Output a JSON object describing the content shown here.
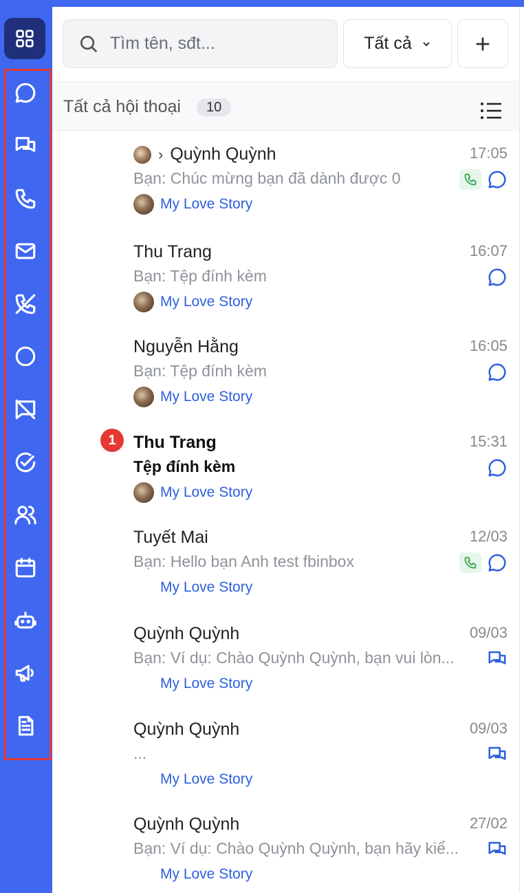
{
  "search": {
    "placeholder": "Tìm tên, sđt..."
  },
  "filter": {
    "label": "Tất cả"
  },
  "list_header": {
    "title": "Tất cả hội thoại",
    "count": "10"
  },
  "conversations": [
    {
      "name": "Quỳnh Quỳnh",
      "time": "17:05",
      "preview": "Bạn: Chúc mừng bạn đã dành được 0",
      "page": "My Love Story"
    },
    {
      "name": "Thu Trang",
      "time": "16:07",
      "preview": "Bạn: Tệp đính kèm",
      "page": "My Love Story"
    },
    {
      "name": "Nguyễn Hằng",
      "time": "16:05",
      "preview": "Bạn: Tệp đính kèm",
      "page": "My Love Story"
    },
    {
      "name": "Thu Trang",
      "time": "15:31",
      "preview": "Tệp đính kèm",
      "page": "My Love Story",
      "unread": "1"
    },
    {
      "name": "Tuyết Mai",
      "time": "12/03",
      "preview": "Bạn: Hello bạn Anh test fbinbox",
      "page": "My Love Story"
    },
    {
      "name": "Quỳnh Quỳnh",
      "time": "09/03",
      "preview": "Bạn: Ví dụ: Chào Quỳnh Quỳnh, bạn vui lòn...",
      "page": "My Love Story"
    },
    {
      "name": "Quỳnh Quỳnh",
      "time": "09/03",
      "preview": "...",
      "page": "My Love Story"
    },
    {
      "name": "Quỳnh Quỳnh",
      "time": "27/02",
      "preview": "Bạn: Ví dụ: Chào Quỳnh Quỳnh, bạn hãy kiể...",
      "page": "My Love Story"
    }
  ],
  "colors": {
    "rail": "#3f67f0",
    "link": "#2d5fe0",
    "unread": "#e53935",
    "call": "#2e9e4a"
  },
  "rail_icons": [
    "apps-icon",
    "chat-icon",
    "conversations-icon",
    "phone-icon",
    "mail-icon",
    "missed-call-icon",
    "circle-icon",
    "no-message-icon",
    "check-circle-icon",
    "users-icon",
    "calendar-icon",
    "bot-icon",
    "megaphone-icon",
    "document-icon"
  ]
}
